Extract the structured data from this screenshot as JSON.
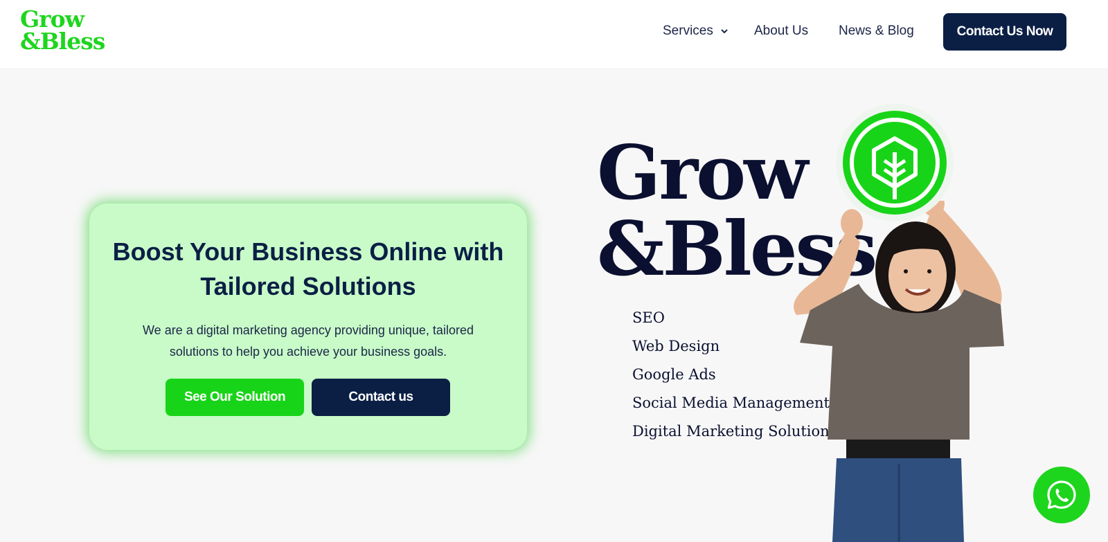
{
  "logo": {
    "line1": "Grow",
    "line2": "&Bless"
  },
  "nav": {
    "services": "Services",
    "about": "About Us",
    "news": "News & Blog",
    "cta": "Contact Us Now"
  },
  "hero": {
    "title": "Boost Your Business Online with Tailored Solutions",
    "description": "We are a digital marketing agency providing unique, tailored solutions to help you achieve your business goals.",
    "primary_button": "See Our Solution",
    "secondary_button": "Contact us"
  },
  "visual": {
    "brand_line1": "Grow",
    "brand_line2": "&Bless",
    "services": [
      "SEO",
      "Web Design",
      "Google Ads",
      "Social Media Management",
      "Digital Marketing Solution"
    ]
  },
  "colors": {
    "brand_green": "#1ed51e",
    "navy": "#0b1f45",
    "card_bg": "#c8fbc8"
  },
  "icons": {
    "chevron": "chevron-down-icon",
    "badge": "leaf-badge-icon",
    "whatsapp": "whatsapp-icon"
  }
}
